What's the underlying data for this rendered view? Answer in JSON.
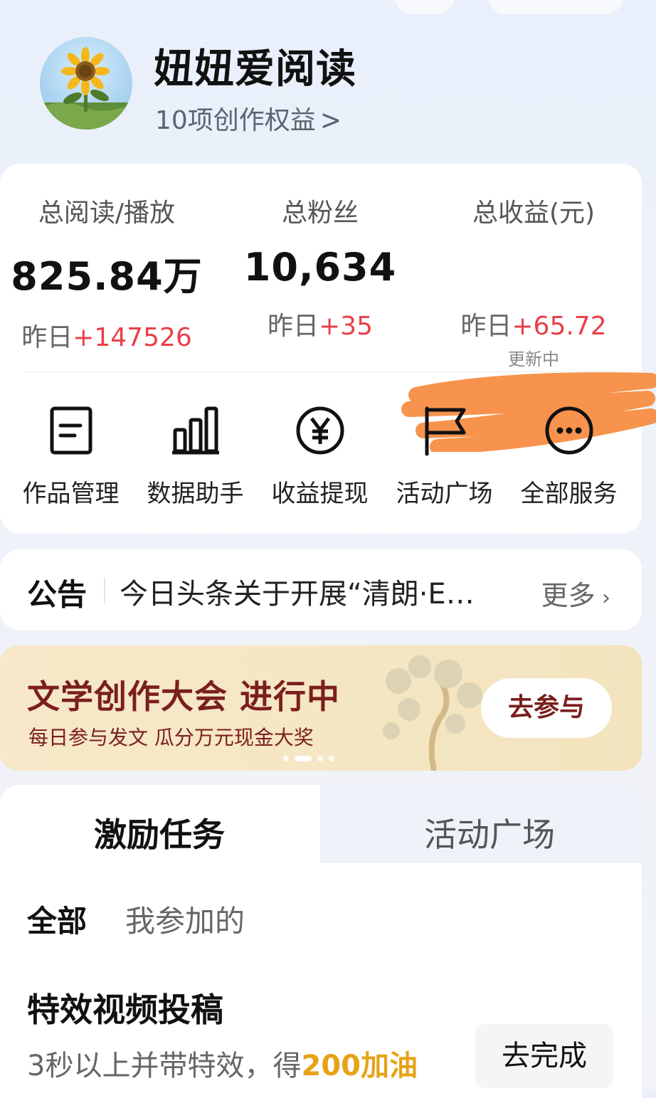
{
  "profile": {
    "username": "妞妞爱阅读",
    "rights_text": "10项创作权益",
    "rights_chevron": ">"
  },
  "stats": [
    {
      "label": "总阅读/播放",
      "value": "825.84万",
      "delta_prefix": "昨日",
      "delta": "+147526",
      "note": ""
    },
    {
      "label": "总粉丝",
      "value": "10,634",
      "delta_prefix": "昨日",
      "delta": "+35",
      "note": ""
    },
    {
      "label": "总收益(元)",
      "value": "",
      "delta_prefix": "昨日",
      "delta": "+65.72",
      "note": "更新中"
    }
  ],
  "services": [
    {
      "label": "作品管理",
      "icon": "document-icon"
    },
    {
      "label": "数据助手",
      "icon": "bar-chart-icon"
    },
    {
      "label": "收益提现",
      "icon": "yen-circle-icon"
    },
    {
      "label": "活动广场",
      "icon": "flag-icon"
    },
    {
      "label": "全部服务",
      "icon": "more-dots-icon"
    }
  ],
  "notice": {
    "title": "公告",
    "text": "今日头条关于开展“清朗·E…",
    "more": "更多"
  },
  "banner": {
    "title": "文学创作大会 进行中",
    "subtitle": "每日参与发文 瓜分万元现金大奖",
    "button": "去参与",
    "active_slide": 2,
    "slide_count": 4
  },
  "tasks": {
    "tabs": [
      "激励任务",
      "活动广场"
    ],
    "active_tab": 0,
    "filters": [
      "全部",
      "我参加的"
    ],
    "items": [
      {
        "title": "特效视频投稿",
        "desc_prefix": "3秒以上并带特效，得",
        "reward": "200加油",
        "button": "去完成"
      }
    ]
  },
  "colors": {
    "accent_red": "#e8404a",
    "banner_text": "#7a1f1c",
    "reward_gold": "#e6a316",
    "redaction_orange": "#f7934c"
  }
}
